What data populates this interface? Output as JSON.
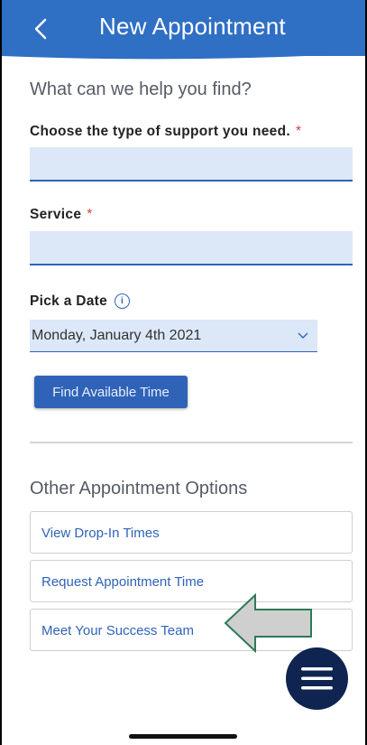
{
  "header": {
    "title": "New Appointment",
    "back_icon": "chevron-left-icon",
    "color": "#2f6fc4"
  },
  "form": {
    "prompt": "What can we help you find?",
    "support_type": {
      "label": "Choose the type of support you need.",
      "required_mark": "*",
      "value": ""
    },
    "service": {
      "label": "Service",
      "required_mark": "*",
      "value": ""
    },
    "date": {
      "label": "Pick a Date",
      "info_icon": "info-icon",
      "selected": "Monday, January 4th 2021"
    },
    "find_button": "Find Available Time"
  },
  "other_options": {
    "title": "Other Appointment Options",
    "items": [
      {
        "label": "View Drop-In Times"
      },
      {
        "label": "Request Appointment Time"
      },
      {
        "label": "Meet Your Success Team"
      }
    ]
  },
  "overlay": {
    "highlight_arrow": "left-arrow-annotation",
    "arrow_fill": "#cfcfcf",
    "arrow_stroke": "#2d7a57"
  },
  "fab": {
    "icon": "menu-icon",
    "color": "#0f2450"
  },
  "accent": "#2f63b8"
}
